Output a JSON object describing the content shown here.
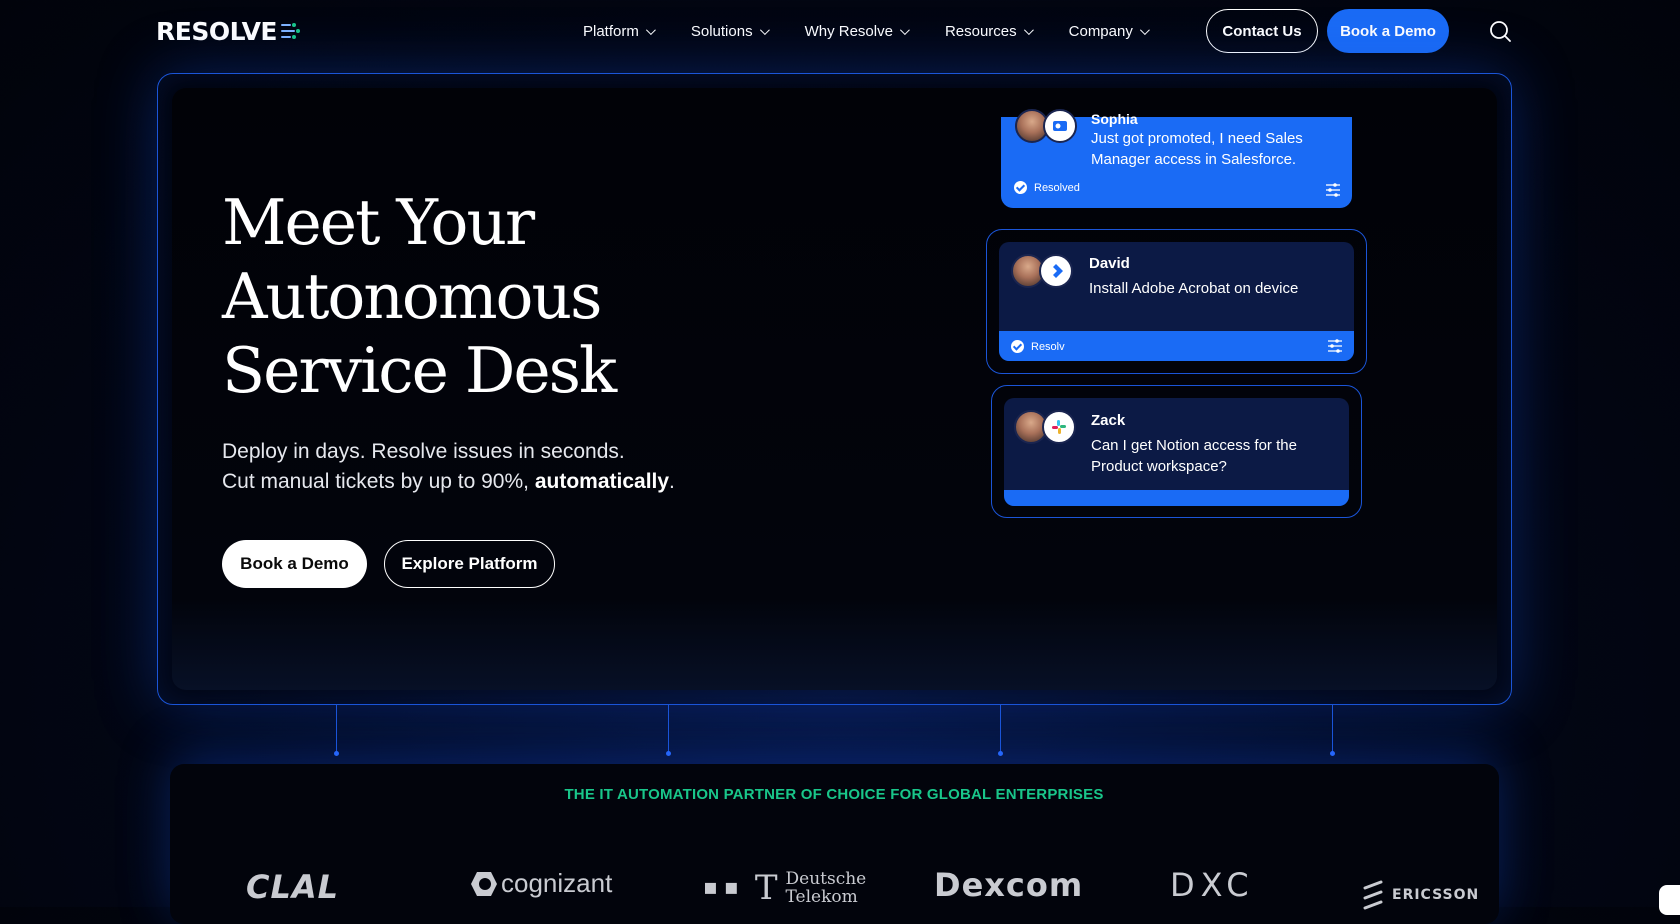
{
  "nav": {
    "logo": "RESOLVE",
    "menu": [
      {
        "label": "Platform"
      },
      {
        "label": "Solutions"
      },
      {
        "label": "Why Resolve"
      },
      {
        "label": "Resources"
      },
      {
        "label": "Company"
      }
    ],
    "contact_label": "Contact Us",
    "demo_label": "Book a Demo",
    "search_icon": "search-icon"
  },
  "hero": {
    "title_line1": "Meet Your",
    "title_line2": "Autonomous",
    "title_line3": "Service Desk",
    "sub_line1": "Deploy in days. Resolve issues in seconds.",
    "sub_line2_prefix": "Cut manual tickets by up to 90%, ",
    "sub_line2_bold": "automatically",
    "sub_line2_suffix": ".",
    "primary_cta": "Book a Demo",
    "secondary_cta": "Explore Platform"
  },
  "chats": [
    {
      "name": "Sophia",
      "message": "Just got promoted, I need Sales Manager access in Salesforce.",
      "status": "Resolved",
      "app_icon": "outlook-icon"
    },
    {
      "name": "David",
      "message": "Install Adobe Acrobat on device",
      "status": "Resolv",
      "app_icon": "jira-icon"
    },
    {
      "name": "Zack",
      "message": "Can I get Notion access for the Product workspace?",
      "app_icon": "slack-icon"
    }
  ],
  "partners": {
    "tagline": "THE IT AUTOMATION PARTNER OF CHOICE FOR GLOBAL ENTERPRISES",
    "brands": [
      "CLAL",
      "cognizant",
      "Deutsche",
      "Telekom",
      "Dexcom",
      "DXC",
      "ERICSSON"
    ]
  },
  "colors": {
    "accent": "#1a6bf5",
    "tagline": "#19c68a",
    "frame": "#1b55d8"
  }
}
